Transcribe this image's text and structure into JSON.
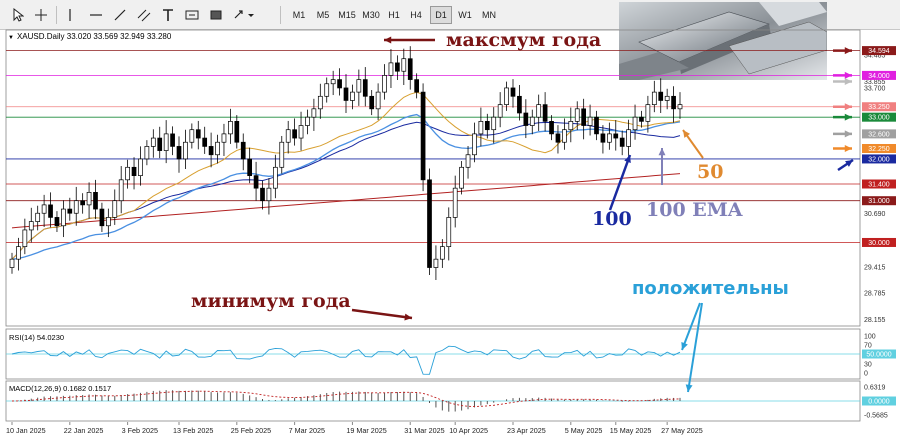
{
  "toolbar": {
    "items": [
      {
        "name": "cursor-icon"
      },
      {
        "name": "crosshair-icon"
      },
      {
        "name": "vertical-line-icon"
      },
      {
        "name": "horizontal-line-icon"
      },
      {
        "name": "trendline-icon"
      },
      {
        "name": "channel-icon"
      },
      {
        "name": "text-icon"
      },
      {
        "name": "label-icon"
      },
      {
        "name": "shapes-icon"
      },
      {
        "name": "arrows-menu-icon"
      }
    ],
    "timeframes": [
      "M1",
      "M5",
      "M15",
      "M30",
      "H1",
      "H4",
      "D1",
      "W1",
      "MN"
    ],
    "active_timeframe": "D1"
  },
  "chart": {
    "header": "XAUSD.Daily  33.020 33.569 32.949 33.280",
    "y_labels": [
      "34.594",
      "34.485",
      "34.000",
      "33.855",
      "33.700",
      "33.250",
      "33.000",
      "32.600",
      "32.250",
      "32.000",
      "31.400",
      "31.000",
      "30.690",
      "30.000",
      "29.415",
      "28.785",
      "28.155"
    ],
    "x_labels": [
      "10 Jan 2025",
      "22 Jan 2025",
      "3 Feb 2025",
      "13 Feb 2025",
      "25 Feb 2025",
      "7 Mar 2025",
      "19 Mar 2025",
      "31 Mar 2025",
      "10 Apr 2025",
      "23 Apr 2025",
      "5 May 2025",
      "15 May 2025",
      "27 May 2025"
    ],
    "rsi": {
      "header": "RSI(14) 54.0230",
      "levels": [
        "100",
        "70",
        "30",
        "0"
      ],
      "value_box": "50.0000"
    },
    "macd": {
      "header": "MACD(12,26,9) 0.1682 0.1517",
      "levels": [
        "0.6319",
        "0.0000",
        "-0.5685"
      ]
    }
  },
  "price_boxes": [
    {
      "label": "34.594",
      "color": "#8b1a1a"
    },
    {
      "label": "34.000",
      "color": "#e020e0"
    },
    {
      "label": "33.250",
      "color": "#f08080"
    },
    {
      "label": "33.000",
      "color": "#1a8a3a"
    },
    {
      "label": "32.600",
      "color": "#a0a0a0"
    },
    {
      "label": "32.250",
      "color": "#f08a2a"
    },
    {
      "label": "32.000",
      "color": "#1a2aa0"
    },
    {
      "label": "31.400",
      "color": "#c02020"
    },
    {
      "label": "31.000",
      "color": "#8b1a1a"
    },
    {
      "label": "30.000",
      "color": "#c02020"
    },
    {
      "label": "50.0000",
      "color": "#60d0e0"
    },
    {
      "label": "0.0000",
      "color": "#60d0e0"
    }
  ],
  "annotations": {
    "max_year": "максмум года",
    "min_year": "минимум года",
    "positive": "положительны",
    "ma50": "50",
    "ma100": "100",
    "ema100": "100 EMA"
  },
  "chart_data": {
    "type": "candlestick",
    "symbol": "XAUSD.Daily",
    "ohlc_header": {
      "open": 33.02,
      "high": 33.569,
      "low": 32.949,
      "close": 33.28
    },
    "ylim": [
      28.0,
      34.8
    ],
    "horizontal_levels": [
      34.594,
      34.0,
      33.25,
      33.0,
      32.0,
      31.4,
      31.0,
      30.0
    ],
    "closes": [
      29.6,
      29.9,
      30.3,
      30.5,
      30.7,
      30.9,
      30.6,
      30.4,
      30.8,
      30.7,
      31.0,
      30.9,
      31.2,
      30.8,
      30.4,
      30.6,
      31.0,
      31.5,
      31.8,
      31.6,
      32.0,
      32.3,
      32.5,
      32.2,
      32.6,
      32.3,
      32.0,
      32.4,
      32.7,
      32.5,
      32.3,
      32.1,
      32.4,
      32.6,
      32.9,
      32.4,
      32.0,
      31.6,
      31.3,
      31.0,
      31.3,
      31.8,
      32.4,
      32.7,
      32.5,
      32.8,
      33.0,
      33.2,
      33.5,
      33.8,
      33.9,
      33.7,
      33.4,
      33.6,
      33.9,
      33.5,
      33.2,
      33.6,
      34.0,
      34.3,
      34.1,
      34.4,
      33.9,
      33.6,
      31.5,
      29.4,
      29.6,
      29.9,
      30.6,
      31.3,
      31.8,
      32.1,
      32.6,
      32.9,
      32.7,
      33.0,
      33.3,
      33.7,
      33.5,
      33.1,
      32.8,
      33.0,
      33.3,
      32.9,
      32.6,
      32.4,
      32.7,
      32.9,
      33.2,
      32.8,
      33.0,
      32.6,
      32.4,
      32.6,
      32.5,
      32.3,
      32.7,
      33.0,
      32.9,
      33.3,
      33.6,
      33.4,
      33.5,
      33.2,
      33.3
    ]
  }
}
